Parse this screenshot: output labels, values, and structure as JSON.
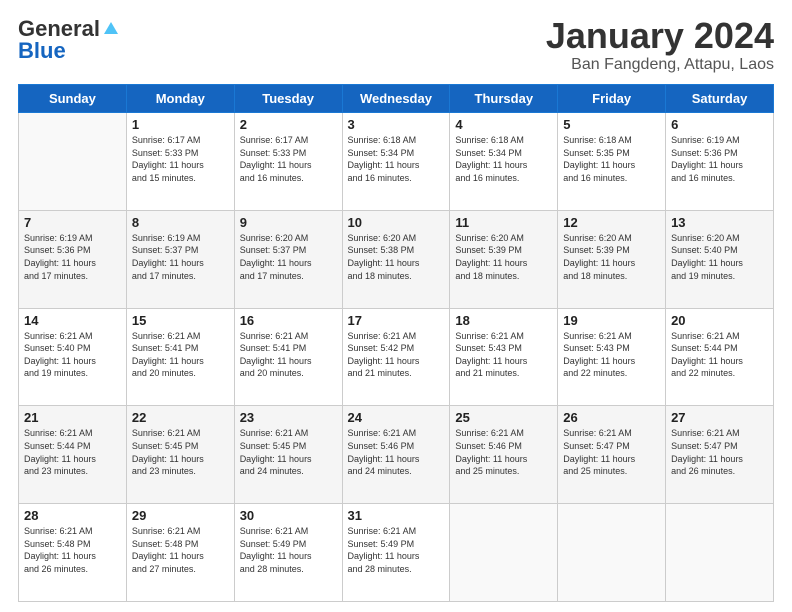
{
  "header": {
    "logo_general": "General",
    "logo_blue": "Blue",
    "title": "January 2024",
    "location": "Ban Fangdeng, Attapu, Laos"
  },
  "weekdays": [
    "Sunday",
    "Monday",
    "Tuesday",
    "Wednesday",
    "Thursday",
    "Friday",
    "Saturday"
  ],
  "weeks": [
    [
      {
        "day": "",
        "info": ""
      },
      {
        "day": "1",
        "info": "Sunrise: 6:17 AM\nSunset: 5:33 PM\nDaylight: 11 hours\nand 15 minutes."
      },
      {
        "day": "2",
        "info": "Sunrise: 6:17 AM\nSunset: 5:33 PM\nDaylight: 11 hours\nand 16 minutes."
      },
      {
        "day": "3",
        "info": "Sunrise: 6:18 AM\nSunset: 5:34 PM\nDaylight: 11 hours\nand 16 minutes."
      },
      {
        "day": "4",
        "info": "Sunrise: 6:18 AM\nSunset: 5:34 PM\nDaylight: 11 hours\nand 16 minutes."
      },
      {
        "day": "5",
        "info": "Sunrise: 6:18 AM\nSunset: 5:35 PM\nDaylight: 11 hours\nand 16 minutes."
      },
      {
        "day": "6",
        "info": "Sunrise: 6:19 AM\nSunset: 5:36 PM\nDaylight: 11 hours\nand 16 minutes."
      }
    ],
    [
      {
        "day": "7",
        "info": "Sunrise: 6:19 AM\nSunset: 5:36 PM\nDaylight: 11 hours\nand 17 minutes."
      },
      {
        "day": "8",
        "info": "Sunrise: 6:19 AM\nSunset: 5:37 PM\nDaylight: 11 hours\nand 17 minutes."
      },
      {
        "day": "9",
        "info": "Sunrise: 6:20 AM\nSunset: 5:37 PM\nDaylight: 11 hours\nand 17 minutes."
      },
      {
        "day": "10",
        "info": "Sunrise: 6:20 AM\nSunset: 5:38 PM\nDaylight: 11 hours\nand 18 minutes."
      },
      {
        "day": "11",
        "info": "Sunrise: 6:20 AM\nSunset: 5:39 PM\nDaylight: 11 hours\nand 18 minutes."
      },
      {
        "day": "12",
        "info": "Sunrise: 6:20 AM\nSunset: 5:39 PM\nDaylight: 11 hours\nand 18 minutes."
      },
      {
        "day": "13",
        "info": "Sunrise: 6:20 AM\nSunset: 5:40 PM\nDaylight: 11 hours\nand 19 minutes."
      }
    ],
    [
      {
        "day": "14",
        "info": "Sunrise: 6:21 AM\nSunset: 5:40 PM\nDaylight: 11 hours\nand 19 minutes."
      },
      {
        "day": "15",
        "info": "Sunrise: 6:21 AM\nSunset: 5:41 PM\nDaylight: 11 hours\nand 20 minutes."
      },
      {
        "day": "16",
        "info": "Sunrise: 6:21 AM\nSunset: 5:41 PM\nDaylight: 11 hours\nand 20 minutes."
      },
      {
        "day": "17",
        "info": "Sunrise: 6:21 AM\nSunset: 5:42 PM\nDaylight: 11 hours\nand 21 minutes."
      },
      {
        "day": "18",
        "info": "Sunrise: 6:21 AM\nSunset: 5:43 PM\nDaylight: 11 hours\nand 21 minutes."
      },
      {
        "day": "19",
        "info": "Sunrise: 6:21 AM\nSunset: 5:43 PM\nDaylight: 11 hours\nand 22 minutes."
      },
      {
        "day": "20",
        "info": "Sunrise: 6:21 AM\nSunset: 5:44 PM\nDaylight: 11 hours\nand 22 minutes."
      }
    ],
    [
      {
        "day": "21",
        "info": "Sunrise: 6:21 AM\nSunset: 5:44 PM\nDaylight: 11 hours\nand 23 minutes."
      },
      {
        "day": "22",
        "info": "Sunrise: 6:21 AM\nSunset: 5:45 PM\nDaylight: 11 hours\nand 23 minutes."
      },
      {
        "day": "23",
        "info": "Sunrise: 6:21 AM\nSunset: 5:45 PM\nDaylight: 11 hours\nand 24 minutes."
      },
      {
        "day": "24",
        "info": "Sunrise: 6:21 AM\nSunset: 5:46 PM\nDaylight: 11 hours\nand 24 minutes."
      },
      {
        "day": "25",
        "info": "Sunrise: 6:21 AM\nSunset: 5:46 PM\nDaylight: 11 hours\nand 25 minutes."
      },
      {
        "day": "26",
        "info": "Sunrise: 6:21 AM\nSunset: 5:47 PM\nDaylight: 11 hours\nand 25 minutes."
      },
      {
        "day": "27",
        "info": "Sunrise: 6:21 AM\nSunset: 5:47 PM\nDaylight: 11 hours\nand 26 minutes."
      }
    ],
    [
      {
        "day": "28",
        "info": "Sunrise: 6:21 AM\nSunset: 5:48 PM\nDaylight: 11 hours\nand 26 minutes."
      },
      {
        "day": "29",
        "info": "Sunrise: 6:21 AM\nSunset: 5:48 PM\nDaylight: 11 hours\nand 27 minutes."
      },
      {
        "day": "30",
        "info": "Sunrise: 6:21 AM\nSunset: 5:49 PM\nDaylight: 11 hours\nand 28 minutes."
      },
      {
        "day": "31",
        "info": "Sunrise: 6:21 AM\nSunset: 5:49 PM\nDaylight: 11 hours\nand 28 minutes."
      },
      {
        "day": "",
        "info": ""
      },
      {
        "day": "",
        "info": ""
      },
      {
        "day": "",
        "info": ""
      }
    ]
  ]
}
